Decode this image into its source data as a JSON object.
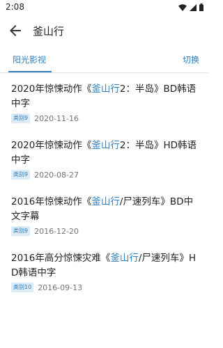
{
  "status_bar": {
    "time": "2:08"
  },
  "app_bar": {
    "title": "釜山行"
  },
  "source": {
    "name": "阳光影视",
    "switch_label": "切换"
  },
  "results": [
    {
      "pre": "2020年惊悚动作《",
      "kw": "釜山行",
      "post": "2：半岛》BD韩语中字",
      "category": "类别9",
      "date": "2020-11-16"
    },
    {
      "pre": "2020年惊悚动作《",
      "kw": "釜山行",
      "post": "2：半岛》HD韩语中字",
      "category": "类别9",
      "date": "2020-08-27"
    },
    {
      "pre": "2016年惊悚动作《",
      "kw": "釜山行",
      "post": "/尸速列车》BD中文字幕",
      "category": "类别9",
      "date": "2016-12-20"
    },
    {
      "pre": "2016年高分惊悚灾难《",
      "kw": "釜山行",
      "post": "/尸速列车》HD韩语中字",
      "category": "类别10",
      "date": "2016-09-13"
    }
  ],
  "colors": {
    "accent": "#2f7fc1",
    "badge_bg": "#dcebf6",
    "divider": "#e3e3e3"
  }
}
